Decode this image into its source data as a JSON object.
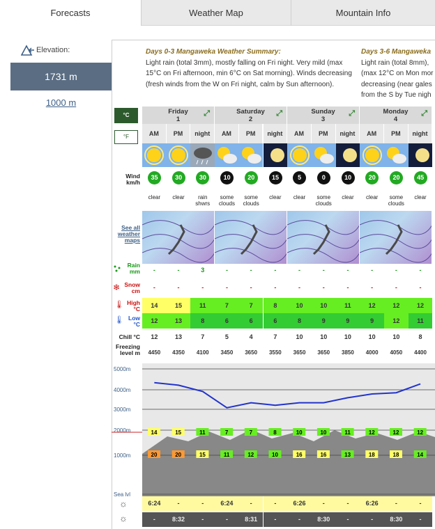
{
  "tabs": [
    {
      "label": "Forecasts"
    },
    {
      "label": "Weather Map"
    },
    {
      "label": "Mountain Info"
    }
  ],
  "elevation": {
    "label": "Elevation:",
    "selected": "1731 m",
    "alternative": "1000 m"
  },
  "summary": [
    {
      "title": "Days 0-3 Mangaweka Weather Summary:",
      "text": "Light rain (total 3mm), mostly falling on Fri night. Very mild (max 15°C on Fri afternoon, min 6°C on Sat morning). Winds decreasing (fresh winds from the W on Fri night, calm by Sun afternoon)."
    },
    {
      "title": "Days 3-6 Mangaweka",
      "text": "Light rain (total 8mm), (max 12°C on Mon mor decreasing (near gales from the S by Tue nigh"
    }
  ],
  "units": {
    "c": "°C",
    "f": "°F"
  },
  "days": [
    {
      "name": "Friday",
      "num": "1"
    },
    {
      "name": "Saturday",
      "num": "2"
    },
    {
      "name": "Sunday",
      "num": "3"
    },
    {
      "name": "Monday",
      "num": "4"
    }
  ],
  "periods": [
    "AM",
    "PM",
    "night",
    "AM",
    "PM",
    "night",
    "AM",
    "PM",
    "night",
    "AM",
    "PM",
    "night"
  ],
  "row_labels": {
    "wind": "Wind km/h",
    "maps": "See all weather maps",
    "rain": "Rain mm",
    "snow": "Snow cm",
    "high": "High °C",
    "low": "Low °C",
    "chill": "Chill °C",
    "freezing": "Freezing level m",
    "sea": "Sea lvl"
  },
  "wind": [
    "35",
    "30",
    "30",
    "10",
    "20",
    "15",
    "5",
    "0",
    "10",
    "20",
    "20",
    "45"
  ],
  "sky": [
    "clear",
    "clear",
    "rain shwrs",
    "some clouds",
    "some clouds",
    "clear",
    "clear",
    "some clouds",
    "clear",
    "clear",
    "some clouds",
    "clear"
  ],
  "weather_icons": [
    "sun",
    "sun",
    "rain-cloud",
    "sun-cloud",
    "sun-cloud",
    "moon",
    "sun",
    "sun-cloud",
    "moon",
    "sun",
    "sun-cloud",
    "moon"
  ],
  "rain": [
    "-",
    "-",
    "3",
    "-",
    "-",
    "-",
    "-",
    "-",
    "-",
    "-",
    "-",
    "-"
  ],
  "snow": [
    "-",
    "-",
    "-",
    "-",
    "-",
    "-",
    "-",
    "-",
    "-",
    "-",
    "-",
    "-"
  ],
  "high": [
    "14",
    "15",
    "11",
    "7",
    "7",
    "8",
    "10",
    "10",
    "11",
    "12",
    "12",
    "12"
  ],
  "low": [
    "12",
    "13",
    "8",
    "6",
    "6",
    "6",
    "8",
    "9",
    "9",
    "9",
    "12",
    "11"
  ],
  "chill": [
    "12",
    "13",
    "7",
    "5",
    "4",
    "7",
    "10",
    "10",
    "10",
    "10",
    "10",
    "8"
  ],
  "freezing": [
    "4450",
    "4350",
    "4100",
    "3450",
    "3650",
    "3550",
    "3650",
    "3650",
    "3850",
    "4000",
    "4050",
    "4400"
  ],
  "alt_labels": [
    "5000m",
    "4000m",
    "3000m",
    "2000m",
    "1000m",
    "Sea lvl"
  ],
  "summit_temps": [
    "14",
    "15",
    "11",
    "7",
    "7",
    "8",
    "10",
    "10",
    "11",
    "12",
    "12",
    "12"
  ],
  "base_temps": [
    "20",
    "20",
    "15",
    "11",
    "12",
    "10",
    "16",
    "16",
    "13",
    "18",
    "18",
    "14"
  ],
  "sunrise": [
    "6:24",
    "-",
    "-",
    "6:24",
    "-",
    "-",
    "6:26",
    "-",
    "-",
    "6:26",
    "-",
    "-"
  ],
  "sunset": [
    "-",
    "8:32",
    "-",
    "-",
    "8:31",
    "-",
    "-",
    "8:30",
    "-",
    "-",
    "8:30",
    "-"
  ],
  "colors": {
    "header_tab": "#e9e9e9",
    "elev_sel": "#5a6d83",
    "high": "#66ee22",
    "yellow": "#ffff66",
    "orange": "#ff9933",
    "wind_green": "#22aa22"
  }
}
